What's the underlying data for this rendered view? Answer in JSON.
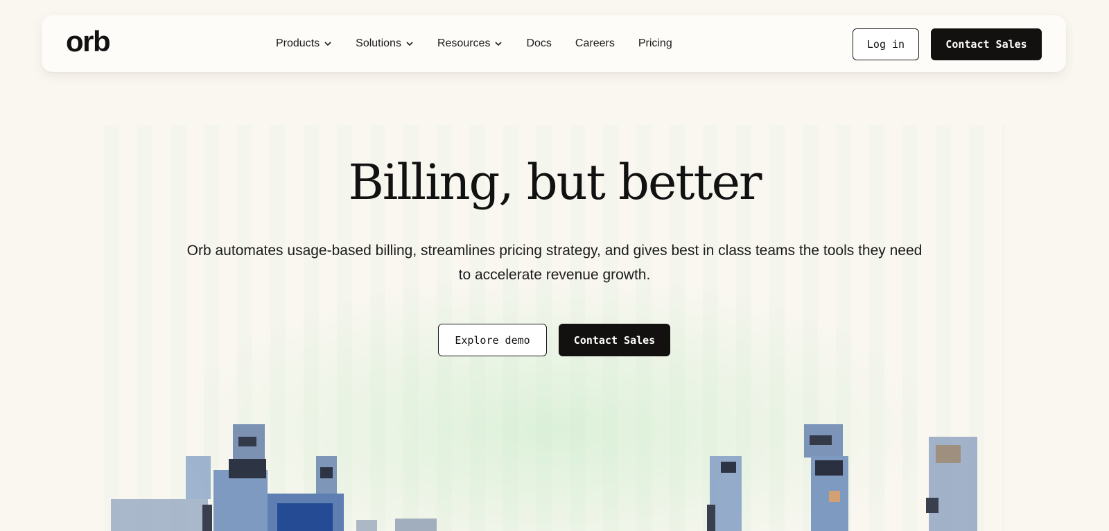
{
  "nav": {
    "logo": "orb",
    "links": [
      {
        "label": "Products",
        "has_dropdown": true
      },
      {
        "label": "Solutions",
        "has_dropdown": true
      },
      {
        "label": "Resources",
        "has_dropdown": true
      },
      {
        "label": "Docs",
        "has_dropdown": false
      },
      {
        "label": "Careers",
        "has_dropdown": false
      },
      {
        "label": "Pricing",
        "has_dropdown": false
      }
    ],
    "login_label": "Log in",
    "contact_label": "Contact Sales"
  },
  "hero": {
    "title": "Billing, but better",
    "subtitle": "Orb automates usage-based billing, streamlines pricing strategy, and gives best in class teams the tools they need to accelerate revenue growth.",
    "explore_label": "Explore demo",
    "contact_label": "Contact Sales"
  },
  "colors": {
    "background": "#faf7f1",
    "primary_button": "#131110",
    "glow": "#c4ecc6",
    "figure_blue": "#6f8fb8"
  },
  "icons": {
    "dropdown": "chevron-down-icon",
    "illustration": "pixel-people-illustration"
  }
}
